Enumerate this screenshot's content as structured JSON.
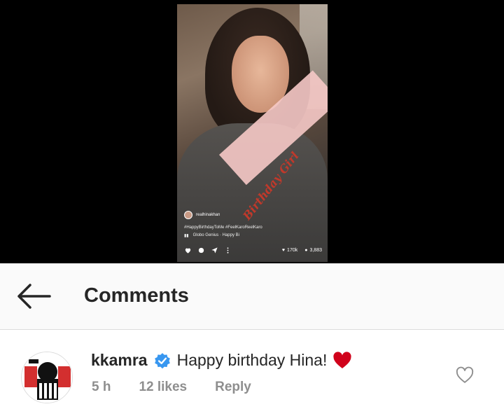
{
  "reel": {
    "sash_text": "Birthday Girl",
    "username": "realhinakhan",
    "caption": "#HappyBirthdayToMe #FeelKaroReelKaro",
    "audio": "Globo Genius · Happy Bi",
    "likes": "170k",
    "comments": "3,883"
  },
  "header": {
    "title": "Comments"
  },
  "comment": {
    "username": "kkamra",
    "text": "Happy birthday Hina!",
    "time": "5 h",
    "likes": "12 likes",
    "reply": "Reply"
  },
  "icons": {
    "back": "arrow-left-icon",
    "verified": "verified-badge-icon",
    "emoji": "red-heart-emoji",
    "like": "heart-outline-icon"
  },
  "colors": {
    "verified_blue": "#3897f0",
    "heart_red": "#d0021b",
    "header_bg": "#fafafa",
    "meta_gray": "#8e8e8e"
  }
}
